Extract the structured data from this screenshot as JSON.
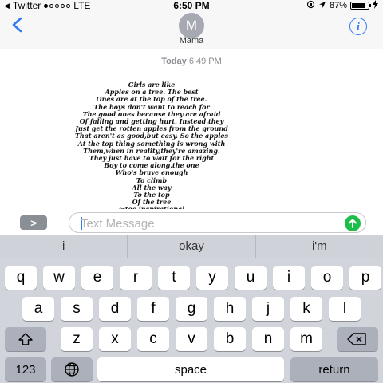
{
  "status": {
    "carrier": "Twitter",
    "signal_bars": 1,
    "network": "LTE",
    "time": "6:50 PM",
    "battery_pct": "87%",
    "battery_level": 0.87
  },
  "header": {
    "avatar_initial": "M",
    "contact_name": "Mama"
  },
  "conversation": {
    "timestamp_day": "Today",
    "timestamp_time": "6:49 PM",
    "poem_lines": [
      "Girls are like",
      "Apples on a tree. The best",
      "Ones are at the top of the tree.",
      "The boys don't want to reach for",
      "The good ones because they are afraid",
      "Of falling and getting hurt. Instead,they",
      "Just get the rotten apples from the ground",
      "That aren't as good,but easy. So the apples",
      "At the top thing something is wrong with",
      "Them,when in reality,they're amazing.",
      "They just have to wait for the right",
      "Boy to come along,the one",
      "Who's brave enough",
      "To climb",
      "All the way",
      "To the top",
      "Of the tree",
      "@too.inspirational"
    ]
  },
  "composer": {
    "app_button": ">",
    "placeholder": "Text Message",
    "value": ""
  },
  "keyboard": {
    "predictions": [
      "i",
      "okay",
      "i'm"
    ],
    "row1": [
      "q",
      "w",
      "e",
      "r",
      "t",
      "y",
      "u",
      "i",
      "o",
      "p"
    ],
    "row2": [
      "a",
      "s",
      "d",
      "f",
      "g",
      "h",
      "j",
      "k",
      "l"
    ],
    "row3": [
      "z",
      "x",
      "c",
      "v",
      "b",
      "n",
      "m"
    ],
    "numbers_label": "123",
    "space_label": "space",
    "return_label": "return"
  },
  "colors": {
    "accent": "#3478f6",
    "send": "#1fbe4a",
    "keyboard_bg": "#d1d4da"
  }
}
